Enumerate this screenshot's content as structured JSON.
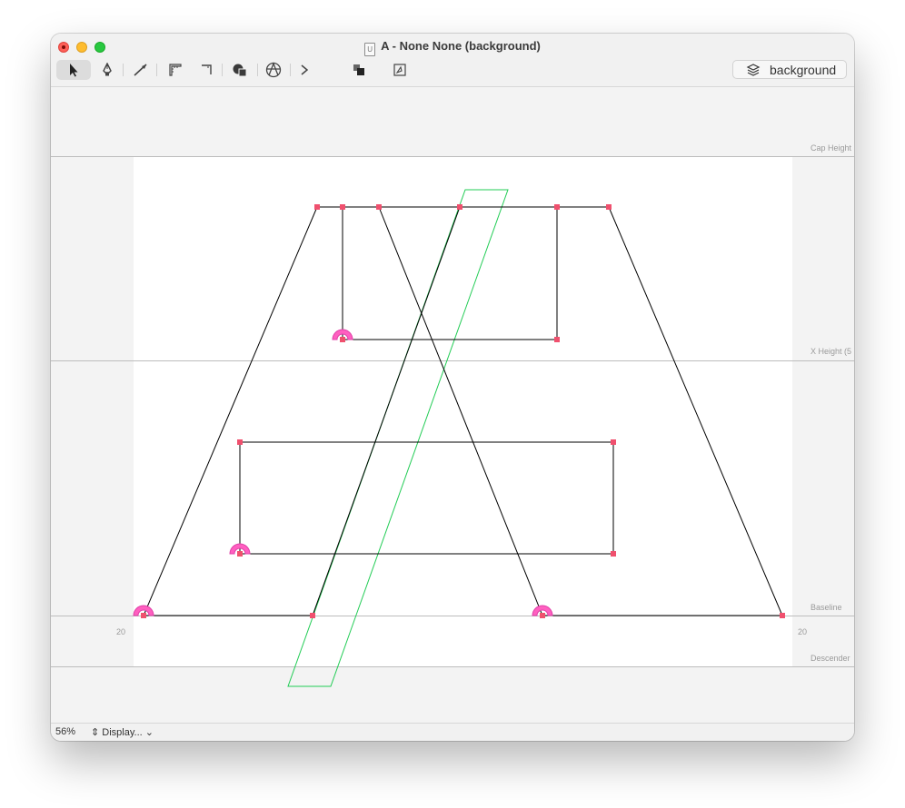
{
  "window": {
    "title": "A - None None (background)",
    "doc_icon_letter": "U"
  },
  "toolbar": {
    "tools": [
      "select-tool",
      "pen-tool",
      "knife-tool",
      "measure-tool",
      "corner-tool",
      "shapes-tool",
      "anchors-tool",
      "more-tools"
    ],
    "layer_button_label": "background"
  },
  "metrics": {
    "cap_height_label": "Cap Height",
    "x_height_label": "X Height (5",
    "baseline_label": "Baseline",
    "descender_label": "Descender",
    "left_sidebearing": "20",
    "right_sidebearing": "20"
  },
  "status": {
    "zoom": "56%",
    "display_menu": "Display..."
  },
  "colors": {
    "node": "#f0506e",
    "start_marker": "#ff5fc0",
    "component_outline": "#22cc55",
    "path": "#000000"
  }
}
